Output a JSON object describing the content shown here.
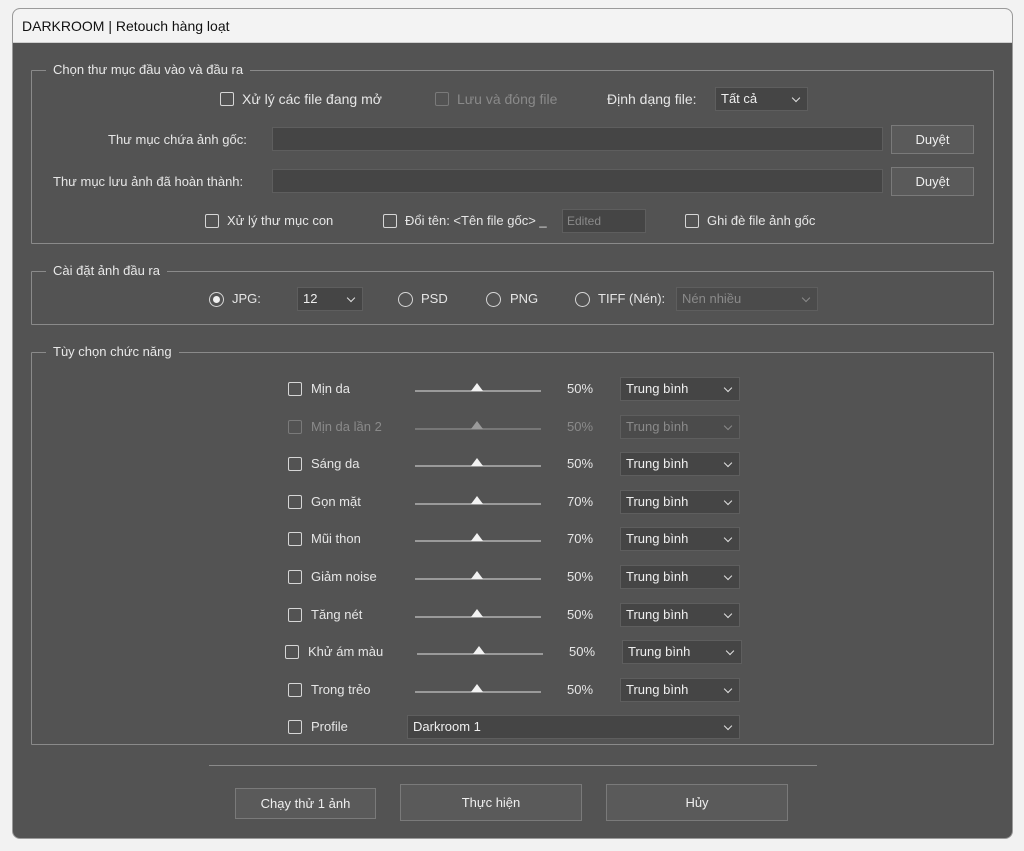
{
  "window": {
    "title": "DARKROOM | Retouch hàng loạt"
  },
  "io": {
    "legend": "Chọn thư mục đầu vào và đầu ra",
    "process_open_label": "Xử lý các file đang mở",
    "save_close_label": "Lưu và đóng file",
    "format_label": "Định dạng file:",
    "format_value": "Tất cả",
    "source_label": "Thư mục chứa ảnh gốc:",
    "dest_label": "Thư mục lưu ảnh đã hoàn thành:",
    "browse_label": "Duyệt",
    "subfolder_label": "Xử lý thư mục con",
    "rename_label": "Đổi tên: <Tên file gốc> _",
    "rename_placeholder": "Edited",
    "overwrite_label": "Ghi đè file ảnh gốc"
  },
  "output": {
    "legend": "Cài đặt ảnh đầu ra",
    "jpg_label": "JPG:",
    "jpg_quality": "12",
    "psd_label": "PSD",
    "png_label": "PNG",
    "tiff_label": "TIFF (Nén):",
    "tiff_compression": "Nén nhiều",
    "selected": "jpg"
  },
  "functions": {
    "legend": "Tùy chọn chức năng",
    "items": [
      {
        "label": "Mịn da",
        "percent": "50%",
        "level": "Trung bình",
        "slider": 0.5,
        "enabled": true
      },
      {
        "label": "Mịn da lần 2",
        "percent": "50%",
        "level": "Trung bình",
        "slider": 0.5,
        "enabled": false
      },
      {
        "label": "Sáng da",
        "percent": "50%",
        "level": "Trung bình",
        "slider": 0.5,
        "enabled": true
      },
      {
        "label": "Gọn mặt",
        "percent": "70%",
        "level": "Trung bình",
        "slider": 0.5,
        "enabled": true
      },
      {
        "label": "Mũi thon",
        "percent": "70%",
        "level": "Trung bình",
        "slider": 0.5,
        "enabled": true
      },
      {
        "label": "Giảm noise",
        "percent": "50%",
        "level": "Trung bình",
        "slider": 0.5,
        "enabled": true
      },
      {
        "label": "Tăng nét",
        "percent": "50%",
        "level": "Trung bình",
        "slider": 0.5,
        "enabled": true
      },
      {
        "label": "Khử ám màu",
        "percent": "50%",
        "level": "Trung bình",
        "slider": 0.5,
        "enabled": true
      },
      {
        "label": "Trong trẻo",
        "percent": "50%",
        "level": "Trung bình",
        "slider": 0.5,
        "enabled": true
      }
    ],
    "profile_label": "Profile",
    "profile_value": "Darkroom 1"
  },
  "footer": {
    "test_run_label": "Chạy thử 1 ảnh",
    "run_label": "Thực hiện",
    "cancel_label": "Hủy"
  }
}
